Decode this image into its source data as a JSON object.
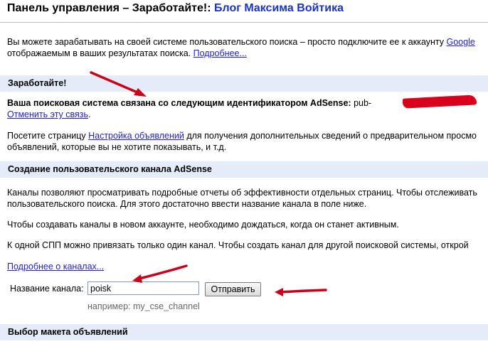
{
  "header": {
    "title": "Панель управления – Заработайте!: ",
    "blog_name": "Блог Максима Войтика"
  },
  "intro": {
    "line1": "Вы можете зарабатывать на своей системе пользовательского поиска – просто подключите ее к аккаунту ",
    "line1_link": "Google",
    "line2": "отображаемым в ваших результатах поиска. ",
    "more_link": "Подробнее..."
  },
  "earn_section": {
    "heading": "Заработайте!",
    "adsense_text": "Ваша поисковая система связана со следующим идентификатором AdSense:",
    "pub_prefix": "pub-",
    "unlink_link": "Отменить эту связь",
    "unlink_suffix": ".",
    "visit_prefix": "Посетите страницу ",
    "ad_settings_link": "Настройка объявлений",
    "visit_suffix": " для получения дополнительных сведений о предварительном просмо",
    "visit_line2": "объявлений, которые вы не хотите показывать, и т.д."
  },
  "channel_section": {
    "heading": "Создание пользовательского канала AdSense",
    "para1_line1": "Каналы позволяют просматривать подробные отчеты об эффективности отдельных страниц. Чтобы отслеживать",
    "para1_line2": "пользовательского поиска. Для этого достаточно ввести название канала в поле ниже.",
    "para2": "Чтобы создавать каналы в новом аккаунте, необходимо дождаться, когда он станет активным.",
    "para3": "К одной СПП можно привязать только один канал. Чтобы создать канал для другой поисковой системы, открой",
    "more_channels_link": "Подробнее о каналах...",
    "channel_label": "Название канала:",
    "channel_value": "poisk",
    "submit_label": "Отправить",
    "hint": "например: my_cse_channel"
  },
  "layout_section": {
    "heading": "Выбор макета объявлений"
  },
  "colors": {
    "band_bg": "#e5ecf9",
    "link": "#2222cc",
    "blog_title": "#1a33c6",
    "annotation_red": "#c8001a"
  }
}
